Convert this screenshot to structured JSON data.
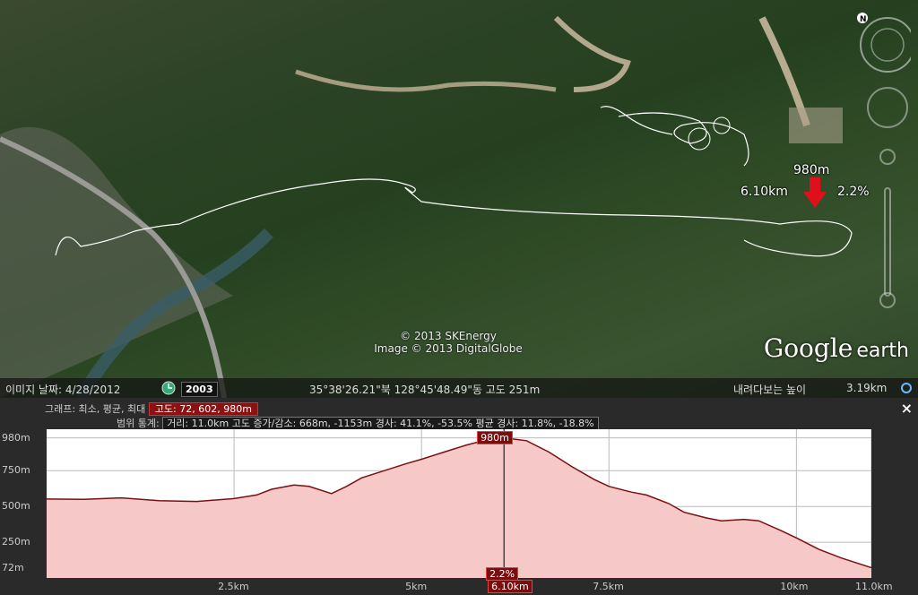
{
  "map": {
    "callout": {
      "elevation": "980m",
      "distance": "6.10km",
      "slope": "2.2%"
    },
    "copyright_line1": "© 2013 SKEnergy",
    "copyright_line2": "Image © 2013 DigitalGlobe",
    "logo_google": "Google",
    "logo_earth": "earth",
    "compass_letter": "N"
  },
  "statusbar": {
    "image_date": "이미지 날짜: 4/28/2012",
    "year": "2003",
    "coords": "35°38'26.21\"북 128°45'48.49\"동 고도  251m",
    "eye_alt_label": "내려다보는 높이",
    "eye_alt": "3.19km"
  },
  "profile": {
    "legend_graph": "그래프: 최소, 평균, 최대",
    "legend_elev": "고도: 72, 602, 980m",
    "legend_range_prefix": "범위 통계:",
    "legend_stats": "거리: 11.0km 고도 증가/감소: 668m, -1153m 경사: 41.1%, -53.5% 평균 경사: 11.8%, -18.8%",
    "close": "×",
    "cursor_elevation": "980m",
    "cursor_slope": "2.2%",
    "cursor_distance": "6.10km"
  },
  "chart_data": {
    "type": "area",
    "title": "",
    "xlabel": "",
    "ylabel": "",
    "xlim": [
      0,
      11.0
    ],
    "ylim": [
      0,
      1040
    ],
    "y_ticks": [
      "980m",
      "750m",
      "500m",
      "250m",
      "72m"
    ],
    "y_tick_values": [
      980,
      750,
      500,
      250,
      72
    ],
    "x_ticks": [
      "2.5km",
      "5km",
      "6.10km",
      "7.5km",
      "10km",
      "11.0km"
    ],
    "x_tick_values": [
      2.5,
      5,
      6.1,
      7.5,
      10,
      11.0
    ],
    "series": [
      {
        "x": [
          0,
          0.5,
          1.0,
          1.5,
          2.0,
          2.5,
          2.8,
          3.0,
          3.3,
          3.5,
          3.8,
          4.0,
          4.2,
          4.5,
          4.8,
          5.0,
          5.3,
          5.6,
          5.9,
          6.1,
          6.4,
          6.7,
          7.0,
          7.3,
          7.5,
          7.8,
          8.0,
          8.3,
          8.5,
          8.8,
          9.0,
          9.3,
          9.5,
          9.8,
          10.0,
          10.3,
          10.6,
          11.0
        ],
        "y": [
          552,
          550,
          560,
          540,
          535,
          555,
          580,
          620,
          650,
          640,
          590,
          640,
          700,
          750,
          800,
          830,
          880,
          930,
          970,
          980,
          960,
          880,
          780,
          690,
          640,
          600,
          580,
          520,
          460,
          420,
          400,
          410,
          400,
          330,
          280,
          200,
          140,
          72
        ]
      }
    ],
    "cursor_x": 6.1,
    "grid": true,
    "fill_color": "#f6c8c8",
    "line_color": "#7a1010"
  }
}
